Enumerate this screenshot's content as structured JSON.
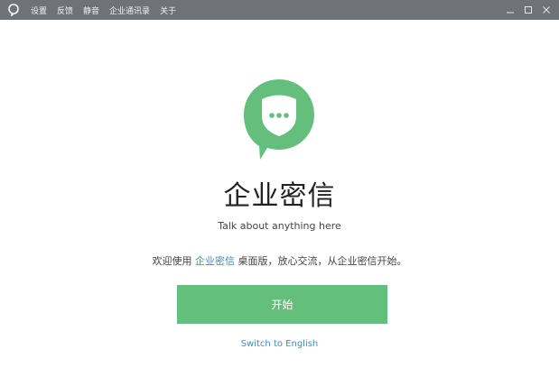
{
  "titlebar": {
    "menu": [
      {
        "id": "settings",
        "label": "设置"
      },
      {
        "id": "feedback",
        "label": "反馈"
      },
      {
        "id": "mute",
        "label": "静音"
      },
      {
        "id": "directory",
        "label": "企业通讯录"
      },
      {
        "id": "about",
        "label": "关于"
      }
    ],
    "controls": {
      "minimize": "_",
      "maximize": "□",
      "close": "×"
    }
  },
  "main": {
    "logo_icon": "chat-bubble-shield-icon",
    "title": "企业密信",
    "tagline": "Talk about anything here",
    "welcome": {
      "prefix": "欢迎使用 ",
      "link": "企业密信",
      "suffix": " 桌面版，放心交流，从企业密信开始。"
    },
    "start_button": "开始",
    "switch_language": "Switch to English"
  },
  "colors": {
    "accent_green": "#65bf7c",
    "link_blue": "#3a8cc4",
    "titlebar_bg": "#6f7378"
  }
}
